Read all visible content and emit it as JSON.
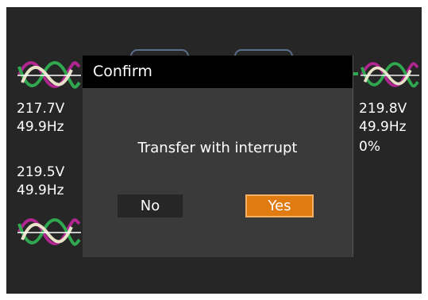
{
  "left_panel": {
    "input1_voltage": "217.7V",
    "input1_frequency": "49.9Hz",
    "input2_voltage": "219.5V",
    "input2_frequency": "49.9Hz"
  },
  "right_panel": {
    "output_voltage": "219.8V",
    "output_frequency": "49.9Hz",
    "load_percent": "0%"
  },
  "dialog": {
    "title": "Confirm",
    "message": "Transfer with interrupt",
    "no_label": "No",
    "yes_label": "Yes"
  },
  "colors": {
    "screen_bg": "#262626",
    "dialog_bg": "#3a3a3a",
    "title_bg": "#000000",
    "yes_button": "#e07b12",
    "wave_purple": "#b0258f",
    "wave_green": "#2fa84f",
    "wave_cream": "#e8e2c8"
  },
  "icons": [
    "sine-wave-icon"
  ]
}
